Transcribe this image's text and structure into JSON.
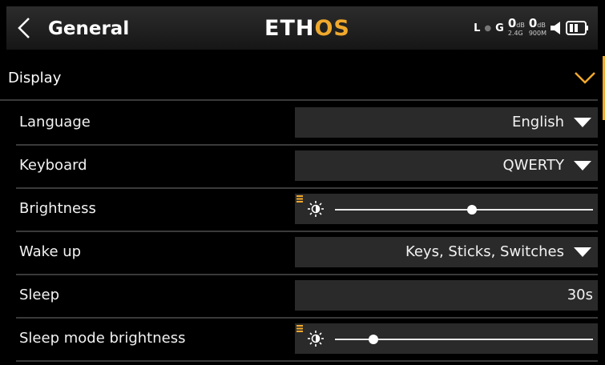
{
  "header": {
    "back_icon": "chevron-left-icon",
    "title": "General",
    "logo_main": "ETH",
    "logo_accent": "OS",
    "status": {
      "telemetry_l": "L",
      "telemetry_g": "G",
      "rssi_24": {
        "value": "0",
        "unit": "dB",
        "band": "2.4G"
      },
      "rssi_900": {
        "value": "0",
        "unit": "dB",
        "band": "900M"
      },
      "volume_icon": "speaker-icon",
      "battery_icon": "battery-icon"
    },
    "accent_color": "#f0a92c"
  },
  "section": {
    "label": "Display",
    "chevron_icon": "chevron-down-icon"
  },
  "rows": [
    {
      "label": "Language",
      "type": "dropdown",
      "value": "English"
    },
    {
      "label": "Keyboard",
      "type": "dropdown",
      "value": "QWERTY"
    },
    {
      "label": "Brightness",
      "type": "slider",
      "level": 0.53
    },
    {
      "label": "Wake up",
      "type": "dropdown",
      "value": "Keys, Sticks, Switches"
    },
    {
      "label": "Sleep",
      "type": "number",
      "value": "30s"
    },
    {
      "label": "Sleep mode brightness",
      "type": "slider",
      "level": 0.15
    }
  ]
}
